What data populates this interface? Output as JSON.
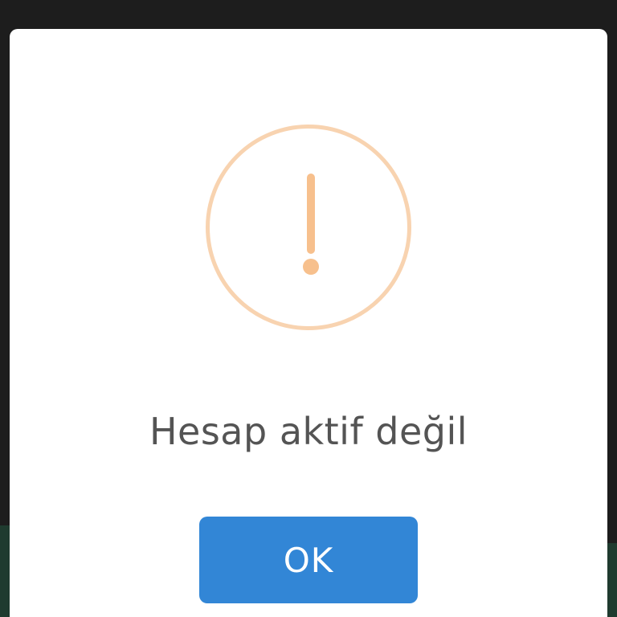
{
  "dialog": {
    "title": "Hesap aktif değil",
    "ok_label": "OK",
    "icon": "exclamation-icon"
  },
  "colors": {
    "accent": "#3286d6",
    "warning_ring": "#f8d3b0",
    "warning_mark": "#f7c08d",
    "title_text": "#545454"
  }
}
